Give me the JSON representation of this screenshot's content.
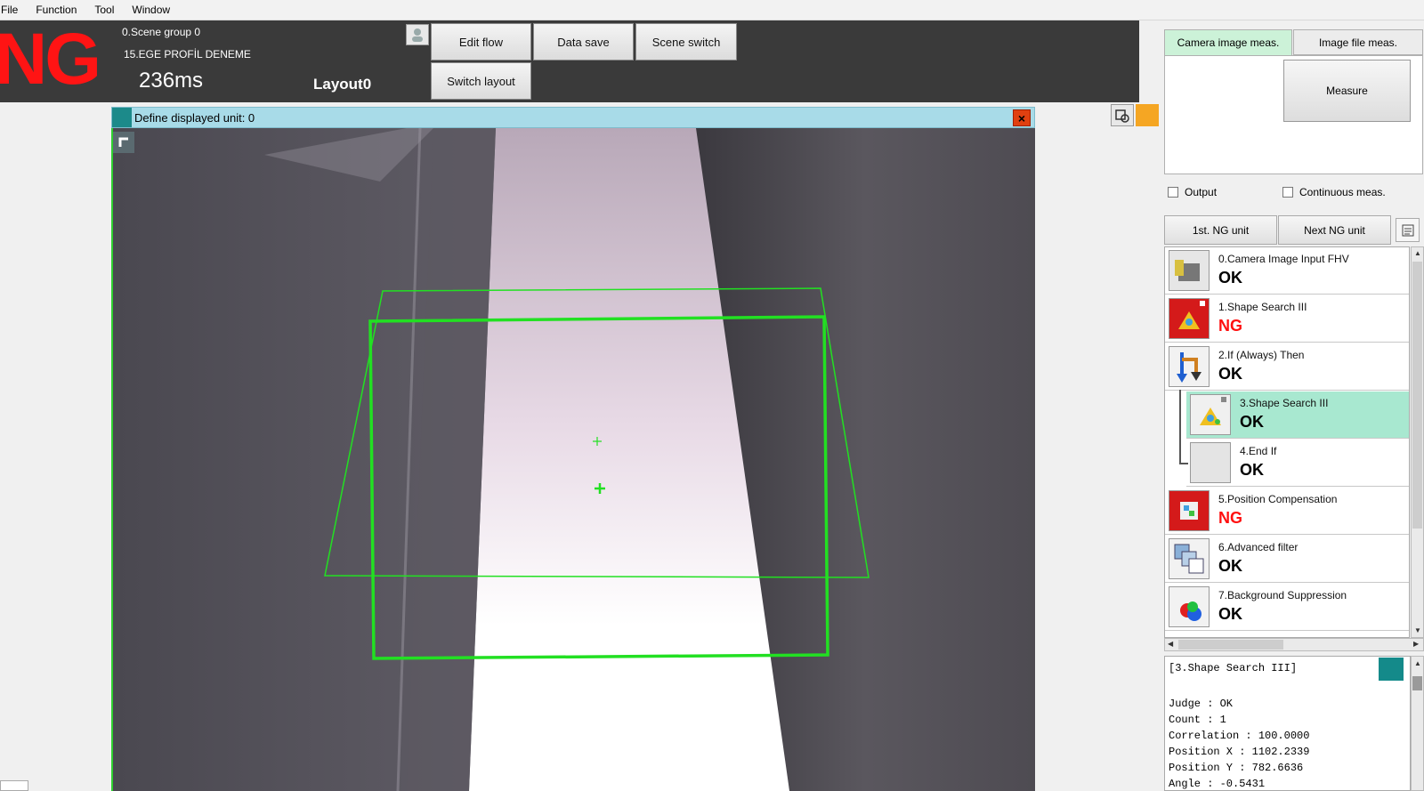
{
  "menu": [
    "File",
    "Function",
    "Tool",
    "Window"
  ],
  "header": {
    "overall_judge": "NG",
    "scene_group": "0.Scene group 0",
    "scene_name": "15.EGE PROFİL DENEME",
    "processing_time": "236ms",
    "layout_name": "Layout0",
    "buttons": {
      "edit_flow": "Edit flow",
      "data_save": "Data save",
      "scene_switch": "Scene switch",
      "switch_layout": "Switch layout"
    }
  },
  "image_window": {
    "title": "Define displayed unit\u0000: 0",
    "close_label": "×"
  },
  "right_panel": {
    "tabs": [
      "Camera image meas.",
      "Image file meas."
    ],
    "measure_button": "Measure",
    "checkbox_output": "Output",
    "checkbox_continuous": "Continuous meas.",
    "first_ng": "1st. NG unit",
    "next_ng": "Next NG unit",
    "flow_items": [
      {
        "label": "0.Camera Image Input FHV",
        "status": "OK",
        "icon": "camera-input-icon"
      },
      {
        "label": "1.Shape Search III",
        "status": "NG",
        "icon": "shape-search-icon"
      },
      {
        "label": "2.If (Always) Then",
        "status": "OK",
        "icon": "if-branch-icon"
      },
      {
        "label": "3.Shape Search III",
        "status": "OK",
        "icon": "shape-search-icon"
      },
      {
        "label": "4.End If",
        "status": "OK",
        "icon": "end-if-icon"
      },
      {
        "label": "5.Position Compensation",
        "status": "NG",
        "icon": "position-compensation-icon"
      },
      {
        "label": "6.Advanced filter",
        "status": "OK",
        "icon": "advanced-filter-icon"
      },
      {
        "label": "7.Background Suppression",
        "status": "OK",
        "icon": "background-suppression-icon"
      }
    ],
    "detail": {
      "title": "[3.Shape Search III]",
      "lines": [
        "Judge : OK",
        "Count : 1",
        "Correlation : 100.0000",
        "Position X : 1102.2339",
        "Position Y : 782.6636",
        "Angle : -0.5431"
      ]
    }
  },
  "colors": {
    "ng": "#ff1010",
    "selected_row": "#a8e8d0",
    "overlay_green": "#22e022",
    "titlebar": "#a8dbe8"
  }
}
